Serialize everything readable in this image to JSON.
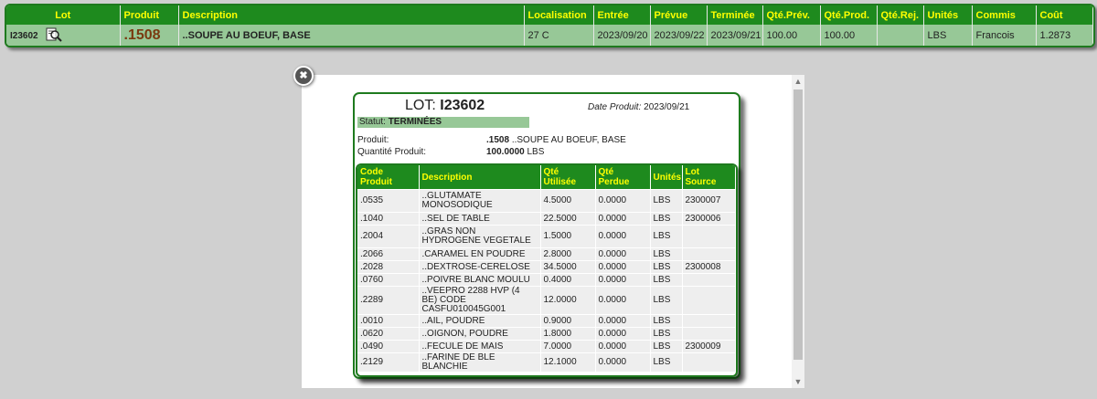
{
  "lot_strip": {
    "headers": [
      "Lot",
      "Produit",
      "Description",
      "Localisation",
      "Entrée",
      "Prévue",
      "Terminée",
      "Qté.Prév.",
      "Qté.Prod.",
      "Qté.Rej.",
      "Unités",
      "Commis",
      "Coût"
    ],
    "row": {
      "lot": "I23602",
      "produit": ".1508",
      "description": "..SOUPE AU BOEUF, BASE",
      "localisation": "27 C",
      "entree": "2023/09/20",
      "prevue": "2023/09/22",
      "terminee": "2023/09/21",
      "qte_prev": "100.00",
      "qte_prod": "100.00",
      "qte_rej": "",
      "unites": "LBS",
      "commis": "Francois",
      "cout": "1.2873"
    },
    "icon": "magnifier-document-icon"
  },
  "popup": {
    "close_icon": "close-icon",
    "lot_label": "LOT:",
    "lot_value": "I23602",
    "date_label": "Date Produit:",
    "date_value": "2023/09/21",
    "statut_label": "Statut:",
    "statut_value": "TERMINÉES",
    "produit_label": "Produit:",
    "produit_code": ".1508",
    "produit_desc": "..SOUPE AU BOEUF, BASE",
    "quantite_label": "Quantité Produit:",
    "quantite_value": "100.0000",
    "quantite_unit": "LBS",
    "ingredients": {
      "headers": [
        "Code Produit",
        "Description",
        "Qté Utilisée",
        "Qté Perdue",
        "Unités",
        "Lot Source"
      ],
      "rows": [
        {
          "code": ".0535",
          "desc": "..GLUTAMATE MONOSODIQUE",
          "used": "4.5000",
          "lost": "0.0000",
          "unit": "LBS",
          "lot": "2300007"
        },
        {
          "code": ".1040",
          "desc": "..SEL DE TABLE",
          "used": "22.5000",
          "lost": "0.0000",
          "unit": "LBS",
          "lot": "2300006"
        },
        {
          "code": ".2004",
          "desc": "..GRAS NON HYDROGENE VEGETALE",
          "used": "1.5000",
          "lost": "0.0000",
          "unit": "LBS",
          "lot": ""
        },
        {
          "code": ".2066",
          "desc": ".CARAMEL EN POUDRE",
          "used": "2.8000",
          "lost": "0.0000",
          "unit": "LBS",
          "lot": ""
        },
        {
          "code": ".2028",
          "desc": "..DEXTROSE-CERELOSE",
          "used": "34.5000",
          "lost": "0.0000",
          "unit": "LBS",
          "lot": "2300008"
        },
        {
          "code": ".0760",
          "desc": "..POIVRE BLANC MOULU",
          "used": "0.4000",
          "lost": "0.0000",
          "unit": "LBS",
          "lot": ""
        },
        {
          "code": ".2289",
          "desc": "..VEEPRO 2288 HVP (4 BE) CODE CASFU010045G001",
          "used": "12.0000",
          "lost": "0.0000",
          "unit": "LBS",
          "lot": ""
        },
        {
          "code": ".0010",
          "desc": "..AIL, POUDRE",
          "used": "0.9000",
          "lost": "0.0000",
          "unit": "LBS",
          "lot": ""
        },
        {
          "code": ".0620",
          "desc": "..OIGNON, POUDRE",
          "used": "1.8000",
          "lost": "0.0000",
          "unit": "LBS",
          "lot": ""
        },
        {
          "code": ".0490",
          "desc": "..FECULE DE MAIS",
          "used": "7.0000",
          "lost": "0.0000",
          "unit": "LBS",
          "lot": "2300009"
        },
        {
          "code": ".2129",
          "desc": "..FARINE DE BLE BLANCHIE",
          "used": "12.1000",
          "lost": "0.0000",
          "unit": "LBS",
          "lot": ""
        }
      ]
    }
  }
}
